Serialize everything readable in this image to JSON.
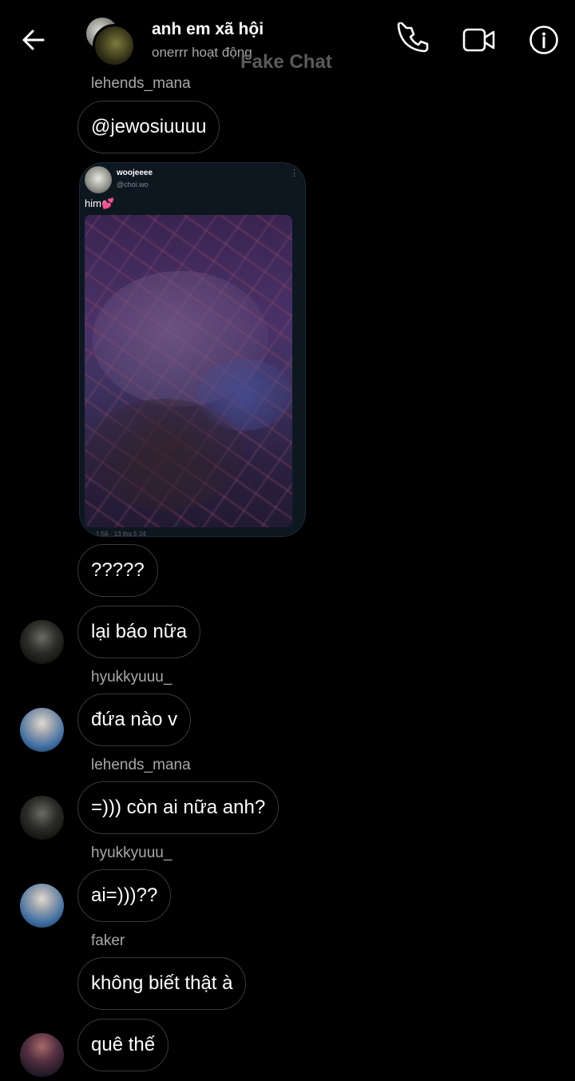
{
  "header": {
    "title": "anh em xã hội",
    "status": "onerrr hoạt động",
    "watermark": "Fake Chat",
    "icons": {
      "back": "back-arrow-icon",
      "call": "phone-icon",
      "video": "video-camera-icon",
      "info": "info-icon"
    }
  },
  "shared_post": {
    "user": "woojeeee",
    "handle": "@choi.wo",
    "caption": "him",
    "caption_emoji": "💕",
    "footer": "1:56 · 13 thg 5 24"
  },
  "messages": [
    {
      "sender": "lehends_mana",
      "text": "@jewosiuuuu"
    },
    {
      "text": "?????"
    },
    {
      "text": "lại báo nữa"
    },
    {
      "sender": "hyukkyuuu_",
      "text": "đứa nào v"
    },
    {
      "sender": "lehends_mana",
      "text": "=))) còn ai nữa anh?"
    },
    {
      "sender": "hyukkyuuu_",
      "text": "ai=)))??"
    },
    {
      "sender": "faker",
      "text": "không biết thật à"
    },
    {
      "text": "quê thế"
    }
  ],
  "colors": {
    "background": "#000000",
    "bubble_border": "#3a3a3a",
    "secondary_text": "#a8a8a8",
    "card_background": "#0d1720"
  }
}
